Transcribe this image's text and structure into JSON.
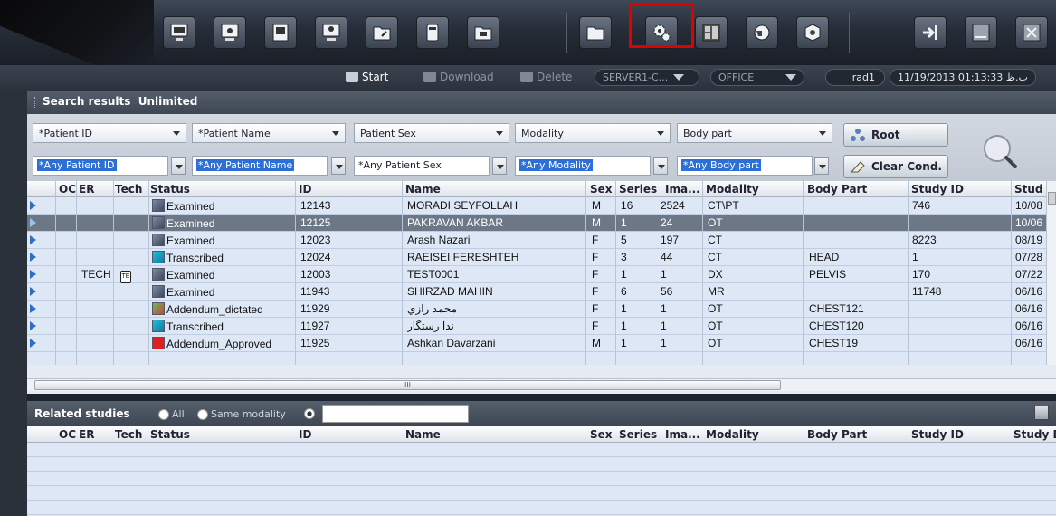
{
  "toolbar": {
    "icons": [
      "workstation-icon",
      "monitor-icon",
      "print-icon",
      "user-monitor-icon",
      "import-folder-icon",
      "burn-disc-icon",
      "export-folder-icon",
      "open-folder-icon",
      "settings-gears-icon",
      "layout-icon",
      "network-globe-icon",
      "package-icon",
      "logout-icon",
      "minimize-icon",
      "close-icon"
    ],
    "highlight_color": "#e00000"
  },
  "status": {
    "start_label": "Start",
    "download_label": "Download",
    "delete_label": "Delete",
    "server_select": "SERVER1-C...",
    "location_select": "OFFICE",
    "user": "rad1",
    "datetime": "11/19/2013 01:13:33 ب.ظ"
  },
  "search": {
    "title": "Search results",
    "subtitle": "Unlimited",
    "filters": [
      {
        "label": "*Patient ID",
        "value": "*Any Patient ID",
        "highlighted": true
      },
      {
        "label": "*Patient Name",
        "value": "*Any Patient Name",
        "highlighted": true
      },
      {
        "label": "Patient Sex",
        "value": "*Any Patient Sex",
        "highlighted": false
      },
      {
        "label": "Modality",
        "value": "*Any Modality",
        "highlighted": true
      },
      {
        "label": "Body part",
        "value": "*Any Body part",
        "highlighted": true
      }
    ],
    "root_button": "Root",
    "clear_button": "Clear Cond."
  },
  "grid": {
    "columns": [
      "OC",
      "ER",
      "Tech",
      "Status",
      "ID",
      "Name",
      "Sex",
      "Series",
      "Ima...",
      "Modality",
      "Body Part",
      "Study ID",
      "Stud"
    ],
    "rows": [
      {
        "oc": "",
        "er": "",
        "tech": "",
        "status": "Examined",
        "status_icon": "examined-icon",
        "id": "12143",
        "name": "MORADI SEYFOLLAH",
        "sex": "M",
        "series": "16",
        "images": "2524",
        "modality": "CT\\PT",
        "body": "",
        "study_id": "746",
        "date": "10/08",
        "selected": false
      },
      {
        "oc": "",
        "er": "",
        "tech": "",
        "status": "Examined",
        "status_icon": "examined-icon",
        "id": "12125",
        "name": "PAKRAVAN AKBAR",
        "sex": "M",
        "series": "1",
        "images": "24",
        "modality": "OT",
        "body": "",
        "study_id": "",
        "date": "10/06",
        "selected": true
      },
      {
        "oc": "",
        "er": "",
        "tech": "",
        "status": "Examined",
        "status_icon": "examined-icon",
        "id": "12023",
        "name": "Arash Nazari",
        "sex": "F",
        "series": "5",
        "images": "197",
        "modality": "CT",
        "body": "",
        "study_id": "8223",
        "date": "08/19",
        "selected": false
      },
      {
        "oc": "",
        "er": "",
        "tech": "",
        "status": "Transcribed",
        "status_icon": "transcribed-icon",
        "id": "12024",
        "name": "RAEISEI FERESHTEH",
        "sex": "F",
        "series": "3",
        "images": "44",
        "modality": "CT",
        "body": "HEAD",
        "study_id": "1",
        "date": "07/28",
        "selected": false
      },
      {
        "oc": "",
        "er": "TECH",
        "tech": "TE",
        "status": "Examined",
        "status_icon": "examined-icon",
        "id": "12003",
        "name": "TEST0001",
        "sex": "F",
        "series": "1",
        "images": "1",
        "modality": "DX",
        "body": "PELVIS",
        "study_id": "170",
        "date": "07/22",
        "selected": false
      },
      {
        "oc": "",
        "er": "",
        "tech": "",
        "status": "Examined",
        "status_icon": "examined-icon",
        "id": "11943",
        "name": "SHIRZAD  MAHIN",
        "sex": "F",
        "series": "6",
        "images": "56",
        "modality": "MR",
        "body": "",
        "study_id": "11748",
        "date": "06/16",
        "selected": false
      },
      {
        "oc": "",
        "er": "",
        "tech": "",
        "status": "Addendum_dictated",
        "status_icon": "addendum-icon",
        "id": "11929",
        "name": "محمد رازي",
        "sex": "F",
        "series": "1",
        "images": "1",
        "modality": "OT",
        "body": "CHEST121",
        "study_id": "",
        "date": "06/16",
        "selected": false
      },
      {
        "oc": "",
        "er": "",
        "tech": "",
        "status": "Transcribed",
        "status_icon": "transcribed-icon",
        "id": "11927",
        "name": "ندا رستگار",
        "sex": "F",
        "series": "1",
        "images": "1",
        "modality": "OT",
        "body": "CHEST120",
        "study_id": "",
        "date": "06/16",
        "selected": false
      },
      {
        "oc": "",
        "er": "",
        "tech": "",
        "status": "Addendum_Approved",
        "status_icon": "approved-icon",
        "id": "11925",
        "name": "Ashkan Davarzani",
        "sex": "M",
        "series": "1",
        "images": "1",
        "modality": "OT",
        "body": "CHEST19",
        "study_id": "",
        "date": "06/16",
        "selected": false
      }
    ],
    "hscroll_label": "III"
  },
  "related": {
    "title": "Related studies",
    "opt_all": "All",
    "opt_same": "Same modality",
    "columns": [
      "OC",
      "ER",
      "Tech",
      "Status",
      "ID",
      "Name",
      "Sex",
      "Series",
      "Ima...",
      "Modality",
      "Body Part",
      "Study ID",
      "Study D"
    ]
  }
}
